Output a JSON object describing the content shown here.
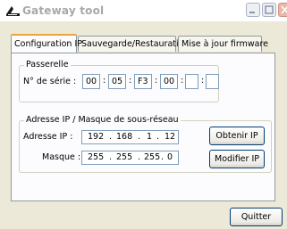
{
  "window": {
    "title": "Gateway tool",
    "icon": "gateway-arrow-icon"
  },
  "tabs": [
    {
      "label": "Configuration IP",
      "active": true
    },
    {
      "label": "Sauvegarde/Restauration",
      "active": false
    },
    {
      "label": "Mise à jour firmware",
      "active": false
    }
  ],
  "passerelle": {
    "group_label": "Passerelle",
    "serial_label": "N° de série :",
    "serial_fields": [
      "00",
      "05",
      "F3",
      "00",
      "",
      ""
    ],
    "separator": ":"
  },
  "network": {
    "group_label": "Adresse IP / Masque de sous-réseau",
    "ip_label": "Adresse IP :",
    "ip_octets": [
      "192",
      "168",
      "1",
      "12"
    ],
    "mask_label": "Masque :",
    "mask_octets": [
      "255",
      "255",
      "255",
      "0"
    ],
    "octet_separator": ".",
    "get_ip_button": "Obtenir IP",
    "modify_ip_button": "Modifier IP"
  },
  "footer": {
    "quit_button": "Quitter"
  },
  "colors": {
    "title_text": "#a8a8a8",
    "dialog_bg": "#ece9d8",
    "tab_highlight": "#e8a63a",
    "border": "#7f9db9"
  }
}
